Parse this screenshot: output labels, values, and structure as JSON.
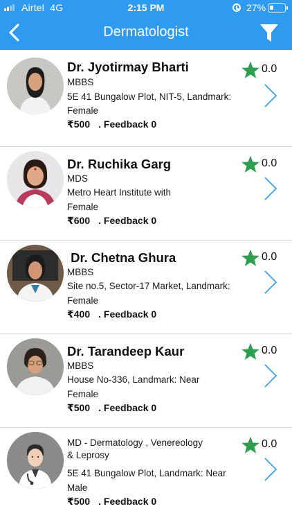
{
  "status_bar": {
    "carrier": "Airtel",
    "network": "4G",
    "time": "2:15 PM",
    "battery_percent": "27%",
    "battery_level": 0.27,
    "signal_bars": 2
  },
  "header": {
    "title": "Dermatologist",
    "back_icon": "chevron-left-icon",
    "filter_icon": "funnel-icon",
    "background": "#2f9bf0"
  },
  "star_color": "#2e9e4f",
  "doctors": [
    {
      "name": "Dr. Jyotirmay Bharti",
      "qualification": "MBBS",
      "address": "5E 41 Bungalow Plot, NIT-5, Landmark:",
      "gender": "Female",
      "fee": "₹500",
      "feedback": ". Feedback 0",
      "rating": "0.0"
    },
    {
      "name": "Dr. Ruchika Garg",
      "qualification": "MDS",
      "address": "Metro Heart Institute with",
      "gender": "Female",
      "fee": "₹600",
      "feedback": ". Feedback 0",
      "rating": "0.0"
    },
    {
      "name": " Dr. Chetna Ghura",
      "qualification": "MBBS",
      "address": "Site no.5, Sector-17 Market, Landmark:",
      "gender": "Female",
      "fee": "₹400",
      "feedback": ". Feedback 0",
      "rating": "0.0"
    },
    {
      "name": "Dr. Tarandeep Kaur",
      "qualification": "MBBS",
      "address": "House No-336, Landmark: Near",
      "gender": "Female",
      "fee": "₹500",
      "feedback": ". Feedback 0",
      "rating": "0.0"
    },
    {
      "name": "",
      "qualification": "MD - Dermatology , Venereology",
      "qualification_line2": "& Leprosy",
      "address": "5E 41 Bungalow Plot, Landmark: Near",
      "gender": "Male",
      "fee": "₹500",
      "feedback": ". Feedback 0",
      "rating": "0.0"
    }
  ]
}
